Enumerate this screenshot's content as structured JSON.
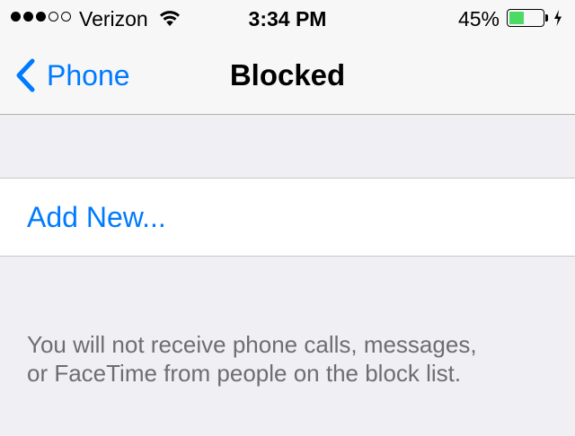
{
  "status_bar": {
    "signal_bars_filled": 3,
    "signal_bars_total": 5,
    "carrier": "Verizon",
    "wifi_icon": "wifi-icon",
    "time": "3:34 PM",
    "battery_percent": "45%",
    "battery_level": 0.45,
    "battery_color": "#4cd964",
    "charging_icon": "bolt-icon"
  },
  "nav": {
    "back_label": "Phone",
    "back_icon": "chevron-left-icon",
    "title": "Blocked"
  },
  "list": {
    "add_new_label": "Add New..."
  },
  "footer": {
    "note_line1": "You will not receive phone calls, messages,",
    "note_line2": "or FaceTime from people on the block list."
  },
  "colors": {
    "accent": "#007aff",
    "background": "#efeff4",
    "secondary_text": "#6d6d72"
  }
}
